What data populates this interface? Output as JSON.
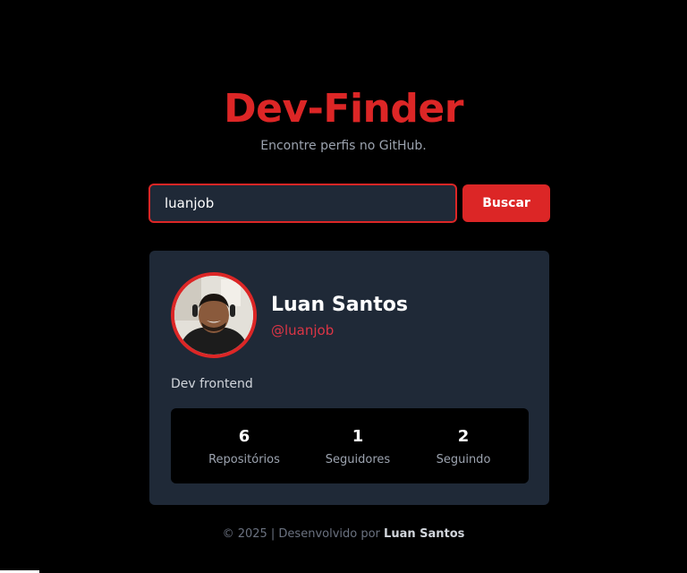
{
  "header": {
    "title": "Dev-Finder",
    "subtitle": "Encontre perfis no GitHub."
  },
  "search": {
    "value": "luanjob",
    "button_label": "Buscar"
  },
  "profile": {
    "name": "Luan Santos",
    "login": "@luanjob",
    "bio": "Dev frontend",
    "stats": [
      {
        "value": "6",
        "label": "Repositórios"
      },
      {
        "value": "1",
        "label": "Seguidores"
      },
      {
        "value": "2",
        "label": "Seguindo"
      }
    ]
  },
  "footer": {
    "text": "© 2025 | Desenvolvido por",
    "author": "Luan Santos"
  },
  "colors": {
    "accent": "#dc2626",
    "background": "#000000",
    "card": "#1f2937"
  }
}
